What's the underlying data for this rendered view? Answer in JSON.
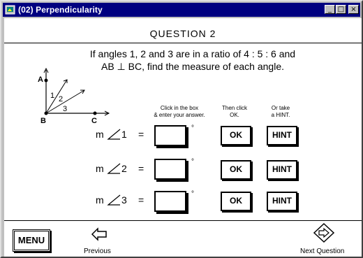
{
  "window": {
    "title": "(02) Perpendicularity",
    "controls": {
      "minimize": "_",
      "maximize": "□",
      "close": "×"
    }
  },
  "question": {
    "heading": "QUESTION  2",
    "line1": "If angles 1, 2 and 3 are in a ratio of 4 : 5 : 6 and",
    "line2": "AB ⊥ BC, find the measure of each angle."
  },
  "diagram": {
    "labels": {
      "A": "A",
      "B": "B",
      "C": "C",
      "a1": "1",
      "a2": "2",
      "a3": "3"
    }
  },
  "instructions": {
    "box": "Click in the box\n& enter your answer.",
    "ok": "Then click\nOK.",
    "hint": "Or take\na HINT."
  },
  "rows": [
    {
      "prefix": "m",
      "angle": "1",
      "equals": "=",
      "value": "",
      "degree": "°",
      "ok": "OK",
      "hint": "HINT"
    },
    {
      "prefix": "m",
      "angle": "2",
      "equals": "=",
      "value": "",
      "degree": "°",
      "ok": "OK",
      "hint": "HINT"
    },
    {
      "prefix": "m",
      "angle": "3",
      "equals": "=",
      "value": "",
      "degree": "°",
      "ok": "OK",
      "hint": "HINT"
    }
  ],
  "footer": {
    "menu": "MENU",
    "previous": "Previous",
    "next": "Next Question"
  }
}
